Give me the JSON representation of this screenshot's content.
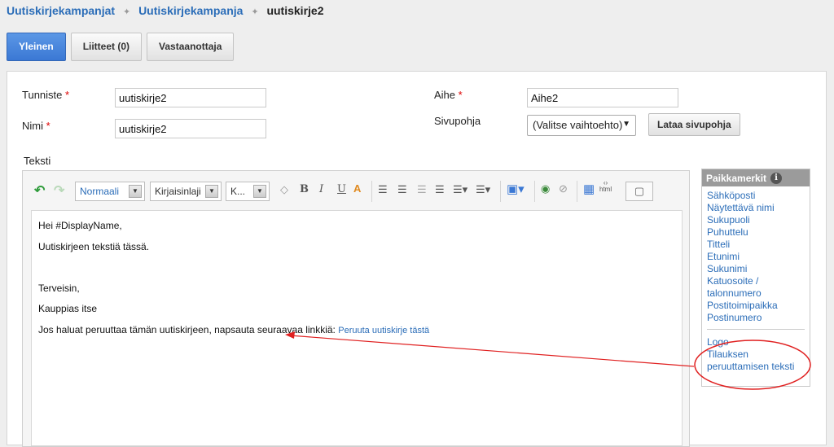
{
  "breadcrumb": {
    "items": [
      "Uutiskirjekampanjat",
      "Uutiskirjekampanja"
    ],
    "current": "uutiskirje2",
    "separator": "✦"
  },
  "tabs": [
    {
      "label": "Yleinen",
      "active": true
    },
    {
      "label": "Liitteet (0)",
      "active": false
    },
    {
      "label": "Vastaanottaja",
      "active": false
    }
  ],
  "form": {
    "tunniste_label": "Tunniste",
    "tunniste_value": "uutiskirje2",
    "nimi_label": "Nimi",
    "nimi_value": "uutiskirje2",
    "aihe_label": "Aihe",
    "aihe_value": "Aihe2",
    "sivupohja_label": "Sivupohja",
    "sivupohja_value": "(Valitse vaihtoehto)",
    "lataa_button": "Lataa sivupohja",
    "required_mark": "*",
    "teksti_label": "Teksti"
  },
  "toolbar": {
    "format": "Normaali",
    "font": "Kirjaisinlaji",
    "size": "K...",
    "bold": "B",
    "italic": "I",
    "underline": "U",
    "html": "html"
  },
  "editor": {
    "line1": "Hei #DisplayName,",
    "line2": "Uutiskirjeen tekstiä tässä.",
    "line3": "Terveisin,",
    "line4": "Kauppias itse",
    "line5": "Jos haluat peruuttaa tämän uutiskirjeen, napsauta seuraavaa linkkiä:",
    "link": "Peruuta uutiskirje tästä"
  },
  "placeholders": {
    "title": "Paikkamerkit",
    "items": [
      "Sähköposti",
      "Näytettävä nimi",
      "Sukupuoli",
      "Puhuttelu",
      "Titteli",
      "Etunimi",
      "Sukunimi",
      "Katuosoite / talonnumero",
      "Postitoimipaikka",
      "Postinumero"
    ],
    "items2": [
      "Logo",
      "Tilauksen peruuttamisen teksti"
    ]
  },
  "colors": {
    "link": "#2b6db8",
    "active_tab": "#3b78d4",
    "annotation": "#e02020"
  }
}
